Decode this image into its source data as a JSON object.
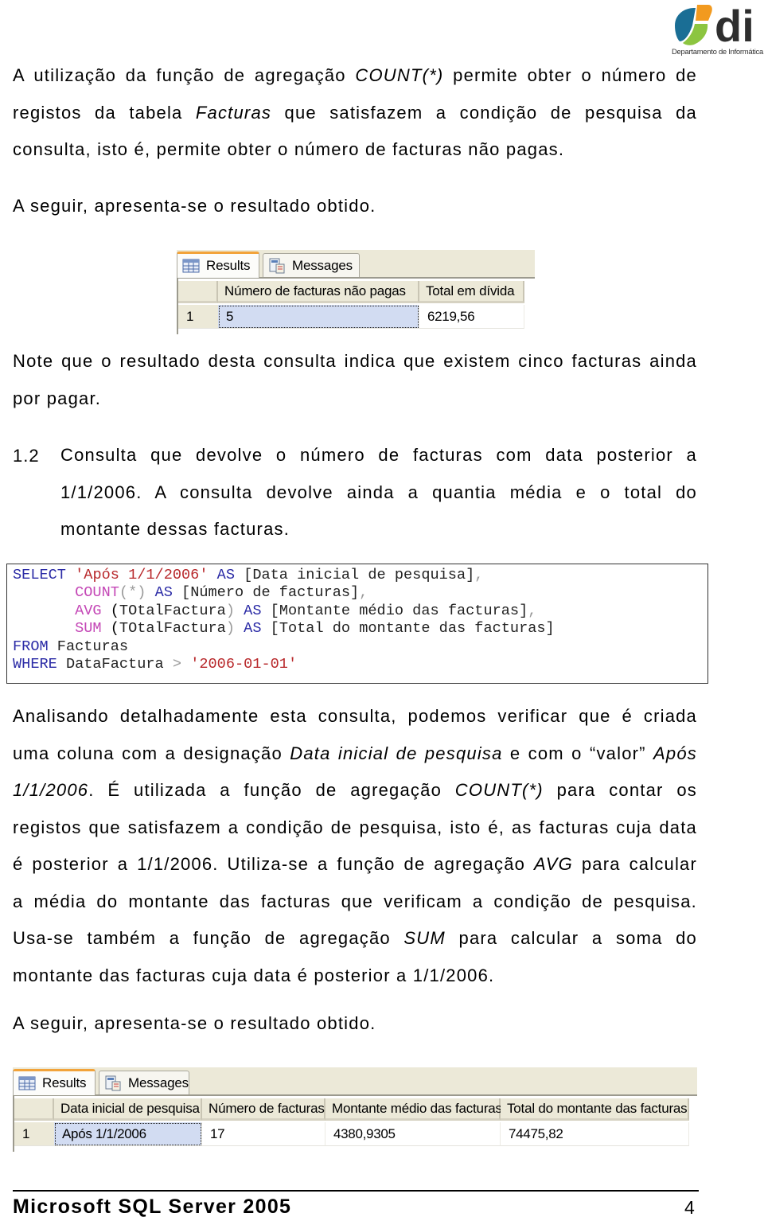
{
  "logo": {
    "wordmark": "di",
    "caption": "Departamento de Informática",
    "colors": {
      "blue": "#1a6e95",
      "orange": "#f29a1f",
      "green": "#8cc540",
      "text": "#2e2e2e"
    }
  },
  "paragraph1": {
    "lines": [
      [
        {
          "t": "A utilização da função de agregação "
        },
        {
          "t": "COUNT(*)",
          "i": true
        },
        {
          "t": " permite obter o número de"
        }
      ],
      [
        {
          "t": "registos da tabela "
        },
        {
          "t": "Facturas",
          "i": true
        },
        {
          "t": " que satisfazem a condição de pesquisa da"
        }
      ],
      [
        {
          "t": "consulta, isto é, permite obter o número de facturas não pagas."
        }
      ]
    ]
  },
  "result_intro_1": "A seguir, apresenta-se o resultado obtido.",
  "results_grid_1": {
    "tabs": [
      {
        "label": "Results",
        "icon": "grid-icon",
        "active": true
      },
      {
        "label": "Messages",
        "icon": "messages-icon",
        "active": false
      }
    ],
    "columns": [
      "Número de facturas não pagas",
      "Total em dívida"
    ],
    "rows": [
      {
        "row_number": "1",
        "cells": [
          "5",
          "6219,56"
        ]
      }
    ]
  },
  "paragraph2": {
    "lines": [
      "Note que o resultado desta consulta indica que existem cinco facturas ainda",
      "por pagar."
    ]
  },
  "section": {
    "number": "1.2",
    "lines": [
      "Consulta que devolve o número de facturas com data posterior a",
      "1/1/2006. A consulta devolve ainda a quantia média e o total do",
      "montante dessas facturas."
    ]
  },
  "sql_code": {
    "lines": [
      [
        {
          "t": "SELECT",
          "c": "kw"
        },
        {
          "t": " "
        },
        {
          "t": "'Após 1/1/2006'",
          "c": "str"
        },
        {
          "t": " "
        },
        {
          "t": "AS",
          "c": "kw"
        },
        {
          "t": " [Data inicial de pesquisa]",
          "c": "id"
        },
        {
          "t": ",",
          "c": "op"
        }
      ],
      [
        {
          "t": "       "
        },
        {
          "t": "COUNT",
          "c": "fn"
        },
        {
          "t": "(*)",
          "c": "op"
        },
        {
          "t": " "
        },
        {
          "t": "AS",
          "c": "kw"
        },
        {
          "t": " [Número de facturas]",
          "c": "id"
        },
        {
          "t": ",",
          "c": "op"
        }
      ],
      [
        {
          "t": "       "
        },
        {
          "t": "AVG",
          "c": "fn"
        },
        {
          "t": " ("
        },
        {
          "t": "TOtalFactura",
          "c": "id"
        },
        {
          "t": ")",
          "c": "op"
        },
        {
          "t": " "
        },
        {
          "t": "AS",
          "c": "kw"
        },
        {
          "t": " [Montante médio das facturas]",
          "c": "id"
        },
        {
          "t": ",",
          "c": "op"
        }
      ],
      [
        {
          "t": "       "
        },
        {
          "t": "SUM",
          "c": "fn"
        },
        {
          "t": " ("
        },
        {
          "t": "TOtalFactura",
          "c": "id"
        },
        {
          "t": ")",
          "c": "op"
        },
        {
          "t": " "
        },
        {
          "t": "AS",
          "c": "kw"
        },
        {
          "t": " [Total do montante das facturas]",
          "c": "id"
        }
      ],
      [
        {
          "t": "FROM",
          "c": "kw"
        },
        {
          "t": " Facturas",
          "c": "id"
        }
      ],
      [
        {
          "t": "WHERE",
          "c": "kw"
        },
        {
          "t": " DataFactura ",
          "c": "id"
        },
        {
          "t": ">",
          "c": "op"
        },
        {
          "t": " "
        },
        {
          "t": "'2006-01-01'",
          "c": "str"
        }
      ]
    ]
  },
  "paragraph3": {
    "lines": [
      {
        "j": true,
        "parts": [
          {
            "t": "Analisando detalhadamente esta consulta, podemos verificar que é criada"
          }
        ]
      },
      {
        "j": true,
        "parts": [
          {
            "t": "uma coluna com a designação "
          },
          {
            "t": "Data inicial de pesquisa",
            "i": true
          },
          {
            "t": " e com o “valor” "
          },
          {
            "t": "Após",
            "i": true
          }
        ]
      },
      {
        "j": true,
        "parts": [
          {
            "t": "1/1/2006",
            "i": true
          },
          {
            "t": ". É utilizada a função de agregação "
          },
          {
            "t": "COUNT(*)",
            "i": true
          },
          {
            "t": " para contar os"
          }
        ]
      },
      {
        "j": true,
        "parts": [
          {
            "t": "registos que satisfazem a condição de pesquisa, isto é, as facturas cuja data"
          }
        ]
      },
      {
        "j": true,
        "parts": [
          {
            "t": "é posterior a 1/1/2006. Utiliza-se a função de agregação "
          },
          {
            "t": "AVG",
            "i": true
          },
          {
            "t": " para calcular"
          }
        ]
      },
      {
        "j": true,
        "parts": [
          {
            "t": "a média do montante das facturas que verificam a condição de pesquisa."
          }
        ]
      },
      {
        "j": true,
        "parts": [
          {
            "t": "Usa-se também a função de agregação "
          },
          {
            "t": "SUM",
            "i": true
          },
          {
            "t": " para calcular a soma do"
          }
        ]
      },
      {
        "j": false,
        "parts": [
          {
            "t": "montante das facturas cuja data é posterior a 1/1/2006."
          }
        ]
      }
    ]
  },
  "result_intro_2": "A seguir, apresenta-se o resultado obtido.",
  "results_grid_2": {
    "tabs": [
      {
        "label": "Results",
        "icon": "grid-icon",
        "active": true
      },
      {
        "label": "Messages",
        "icon": "messages-icon",
        "active": false
      }
    ],
    "columns": [
      "Data inicial de pesquisa",
      "Número de facturas",
      "Montante médio das facturas",
      "Total do montante das facturas"
    ],
    "rows": [
      {
        "row_number": "1",
        "cells": [
          "Após 1/1/2006",
          "17",
          "4380,9305",
          "74475,82"
        ]
      }
    ]
  },
  "footer": {
    "title": "Microsoft SQL Server 2005",
    "page_number": "4"
  }
}
